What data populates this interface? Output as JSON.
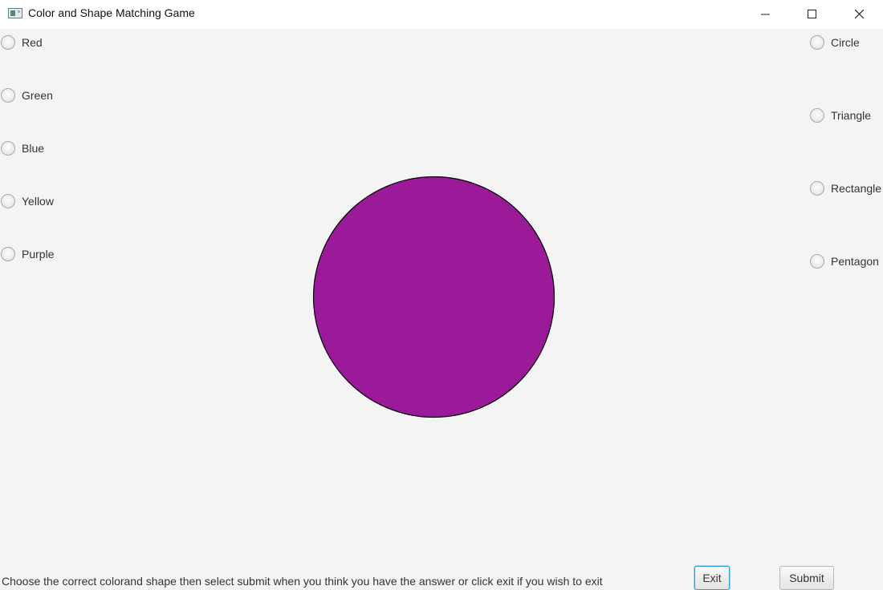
{
  "window": {
    "title": "Color and Shape Matching Game",
    "app_icon": "app-window-icon",
    "controls": {
      "minimize_icon": "minimize-icon",
      "maximize_icon": "maximize-icon",
      "close_icon": "close-icon"
    }
  },
  "colors": {
    "options": [
      {
        "label": "Red",
        "selected": false
      },
      {
        "label": "Green",
        "selected": false
      },
      {
        "label": "Blue",
        "selected": false
      },
      {
        "label": "Yellow",
        "selected": false
      },
      {
        "label": "Purple",
        "selected": false
      }
    ]
  },
  "shapes": {
    "options": [
      {
        "label": "Circle",
        "selected": false
      },
      {
        "label": "Triangle",
        "selected": false
      },
      {
        "label": "Rectangle",
        "selected": false
      },
      {
        "label": "Pentagon",
        "selected": false
      }
    ]
  },
  "display": {
    "shape": "circle",
    "fill_color": "#9a1a9a",
    "stroke_color": "#000000"
  },
  "footer": {
    "instructions": "Choose the correct colorand shape then select submit when you think you have the answer or click exit if you wish to exit",
    "exit_label": "Exit",
    "submit_label": "Submit"
  }
}
